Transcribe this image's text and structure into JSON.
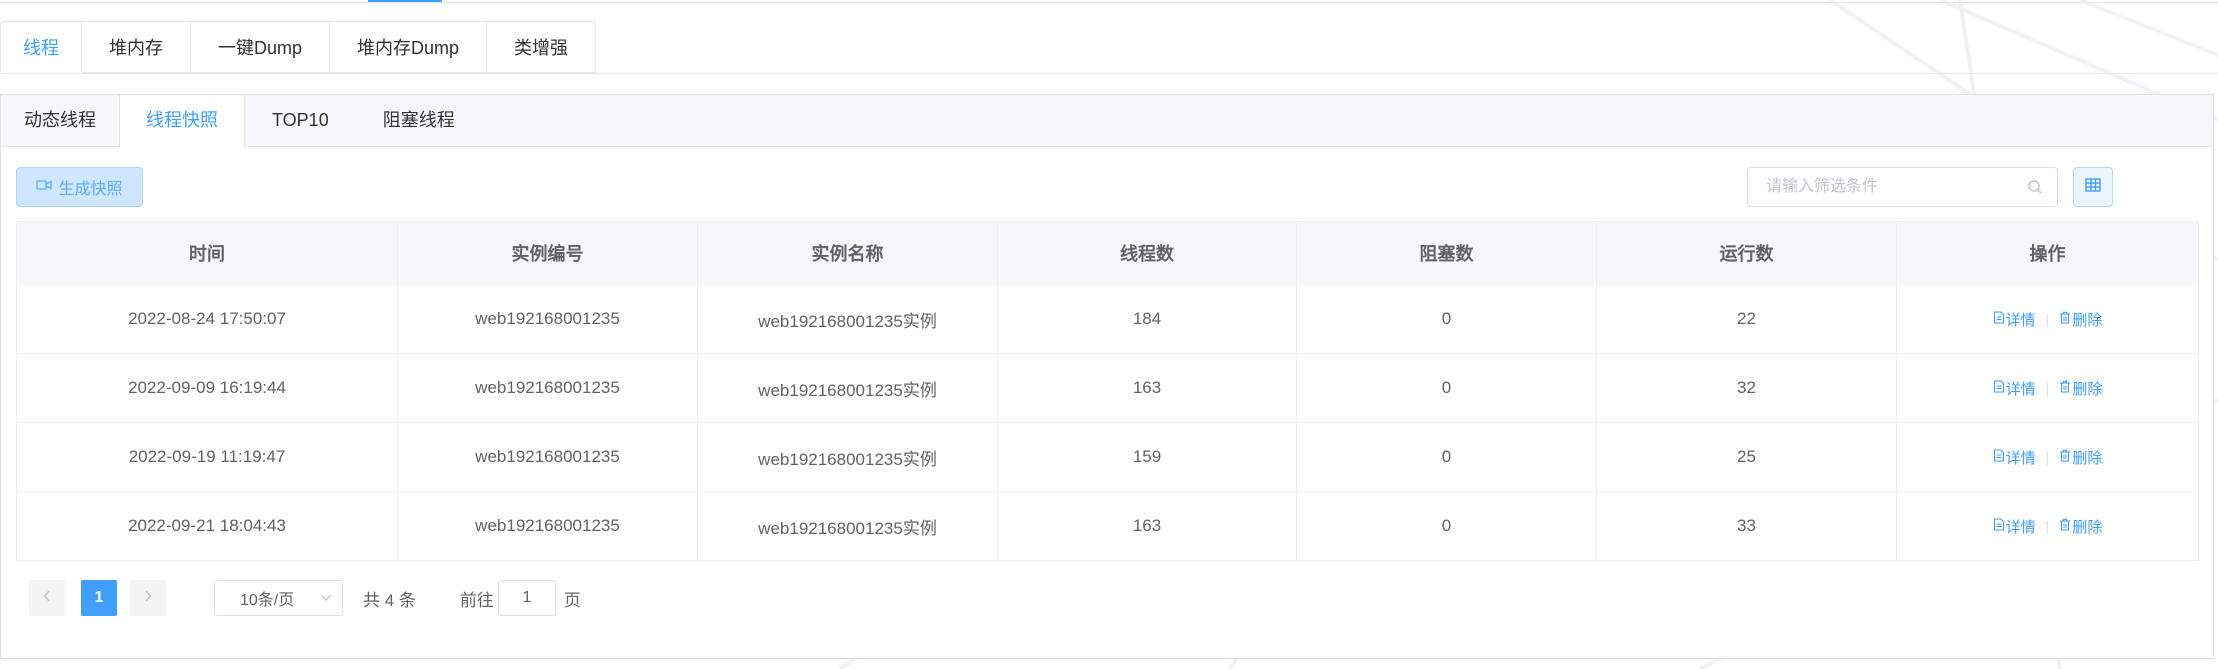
{
  "outer_tabs": [
    "线程",
    "堆内存",
    "一键Dump",
    "堆内存Dump",
    "类增强"
  ],
  "inner_tabs": [
    "动态线程",
    "线程快照",
    "TOP10",
    "阻塞线程"
  ],
  "active_outer_tab": "线程",
  "active_inner_tab": "线程快照",
  "toolbar": {
    "snapshot_button": "生成快照",
    "filter_placeholder": "请输入筛选条件"
  },
  "table": {
    "columns": [
      "时间",
      "实例编号",
      "实例名称",
      "线程数",
      "阻塞数",
      "运行数",
      "操作"
    ],
    "rows": [
      {
        "time": "2022-08-24 17:50:07",
        "instance_id": "web192168001235",
        "instance_name": "web192168001235实例",
        "threads": "184",
        "blocked": "0",
        "running": "22"
      },
      {
        "time": "2022-09-09 16:19:44",
        "instance_id": "web192168001235",
        "instance_name": "web192168001235实例",
        "threads": "163",
        "blocked": "0",
        "running": "32"
      },
      {
        "time": "2022-09-19 11:19:47",
        "instance_id": "web192168001235",
        "instance_name": "web192168001235实例",
        "threads": "159",
        "blocked": "0",
        "running": "25"
      },
      {
        "time": "2022-09-21 18:04:43",
        "instance_id": "web192168001235",
        "instance_name": "web192168001235实例",
        "threads": "163",
        "blocked": "0",
        "running": "33"
      }
    ],
    "actions": {
      "detail": "详情",
      "delete": "删除"
    }
  },
  "pagination": {
    "current_page": "1",
    "page_size": "10条/页",
    "total": "共 4 条",
    "goto_label": "前往",
    "goto_value": "1",
    "page_suffix": "页"
  },
  "colors": {
    "accent": "#409eff",
    "border": "#dcdfe6",
    "header_bg": "#f5f7fa"
  },
  "icons": {
    "snapshot": "video-camera-icon",
    "search": "search-icon",
    "grid": "grid-icon",
    "detail": "document-icon",
    "delete": "trash-icon",
    "prev": "chevron-left-icon",
    "next": "chevron-right-icon",
    "dropdown": "chevron-down-icon"
  }
}
